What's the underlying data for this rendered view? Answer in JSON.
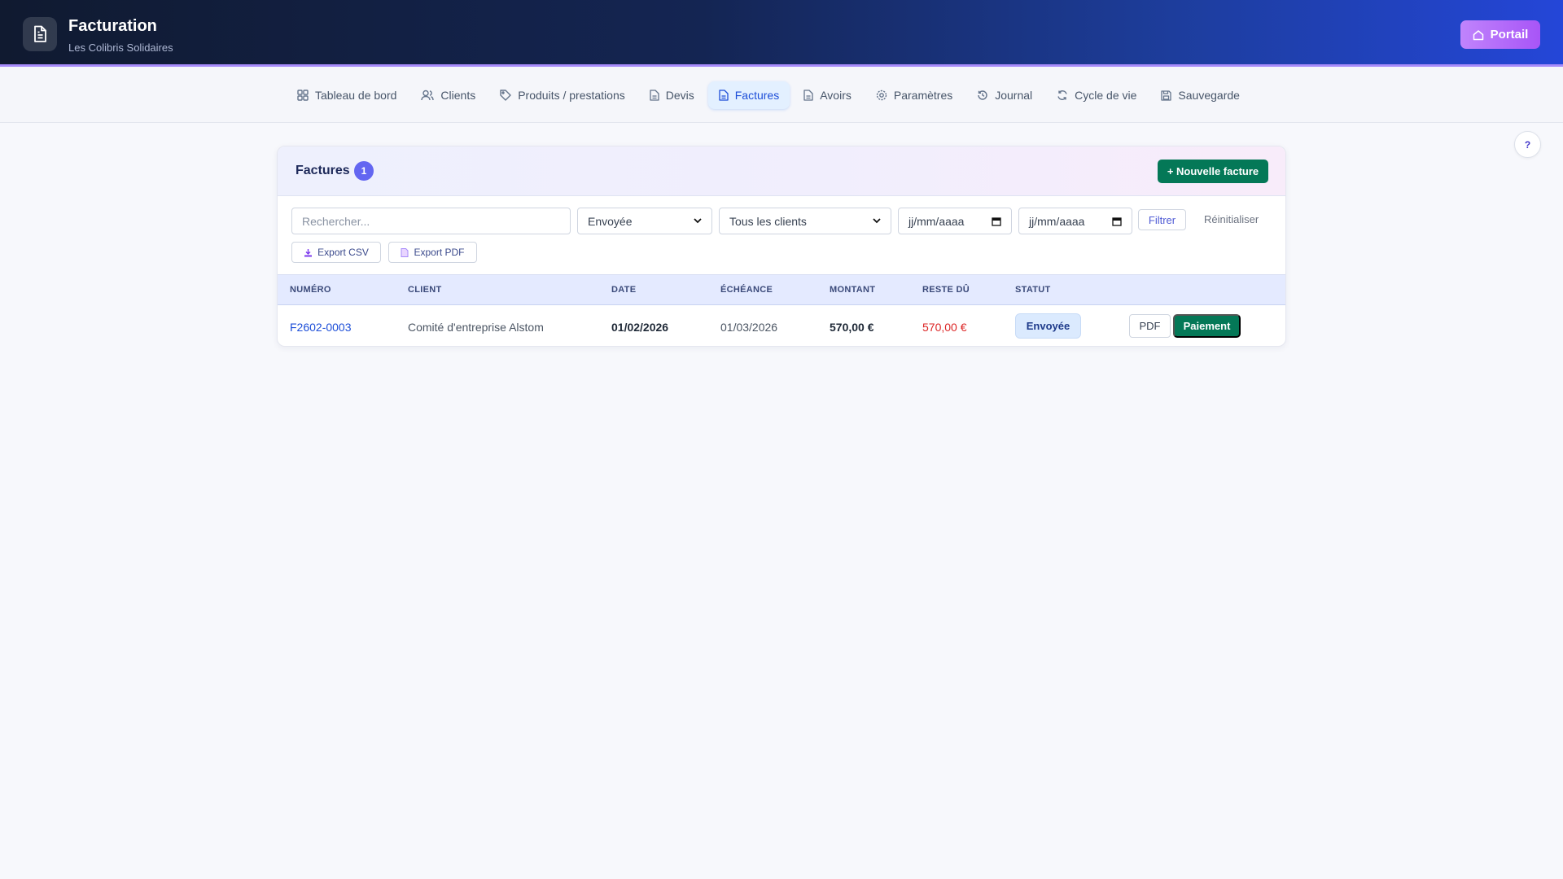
{
  "header": {
    "title": "Facturation",
    "subtitle": "Les Colibris Solidaires",
    "logo_icon": "document-icon",
    "portal_label": "Portail",
    "portal_icon": "home-icon"
  },
  "nav": {
    "items": [
      {
        "label": "Tableau de bord",
        "icon": "grid-icon",
        "active": false
      },
      {
        "label": "Clients",
        "icon": "users-icon",
        "active": false
      },
      {
        "label": "Produits / prestations",
        "icon": "tag-icon",
        "active": false
      },
      {
        "label": "Devis",
        "icon": "file-icon",
        "active": false
      },
      {
        "label": "Factures",
        "icon": "invoice-icon",
        "active": true
      },
      {
        "label": "Avoirs",
        "icon": "file-icon",
        "active": false
      },
      {
        "label": "Paramètres",
        "icon": "gear-icon",
        "active": false
      },
      {
        "label": "Journal",
        "icon": "history-icon",
        "active": false
      },
      {
        "label": "Cycle de vie",
        "icon": "refresh-icon",
        "active": false
      },
      {
        "label": "Sauvegarde",
        "icon": "save-icon",
        "active": false
      }
    ],
    "accent": "#1d4ed8"
  },
  "help": {
    "label": "?"
  },
  "card": {
    "title": "Factures",
    "count": "1",
    "new_button": "+ Nouvelle facture"
  },
  "filters": {
    "search_placeholder": "Rechercher...",
    "status_value": "Envoyée",
    "client_value": "Tous les clients",
    "date_from": "jj/mm/aaaa",
    "date_to": "jj/mm/aaaa",
    "filter_label": "Filtrer",
    "reset_label": "Réinitialiser",
    "export_csv": "Export CSV",
    "export_pdf": "Export PDF"
  },
  "table": {
    "columns": [
      "NUMÉRO",
      "CLIENT",
      "DATE",
      "ÉCHÉANCE",
      "MONTANT",
      "RESTE DÛ",
      "STATUT"
    ],
    "rows": [
      {
        "number": "F2602-0003",
        "client": "Comité d'entreprise Alstom",
        "date": "01/02/2026",
        "due": "01/03/2026",
        "amount": "570,00 €",
        "remaining": "570,00 €",
        "status": "Envoyée",
        "pdf_label": "PDF",
        "pay_label": "Paiement"
      }
    ]
  },
  "colors": {
    "primary_green": "#047857",
    "badge_purple": "#6366f1",
    "status_blue": "#dbeafe",
    "due_red": "#dc2626"
  }
}
